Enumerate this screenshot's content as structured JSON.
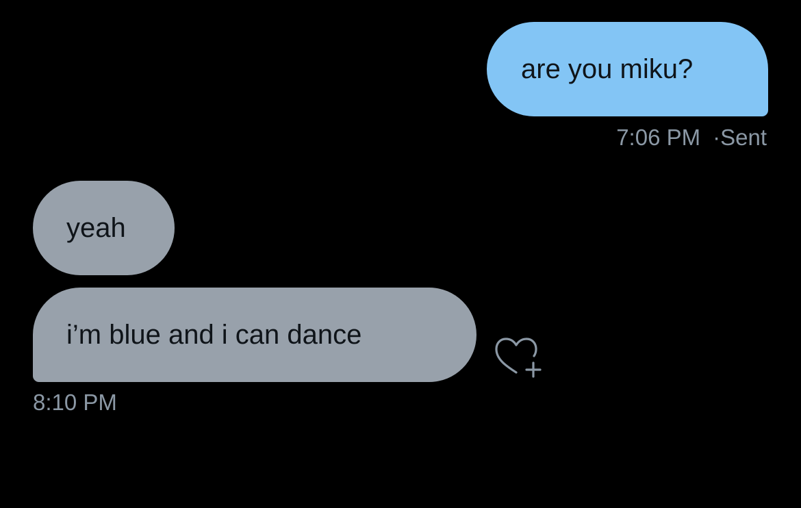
{
  "conversation": {
    "messages": [
      {
        "direction": "sent",
        "text": "are you miku?",
        "time": "7:06 PM",
        "separator": "·",
        "status": "Sent"
      },
      {
        "direction": "received",
        "text": "yeah"
      },
      {
        "direction": "received",
        "text": "i’m blue and i can dance",
        "time": "8:10 PM"
      }
    ]
  },
  "icons": {
    "reaction": "heart-plus-icon"
  },
  "colors": {
    "background": "#000000",
    "sent_bubble": "#83c5f5",
    "received_bubble": "#98a1ab",
    "bubble_text": "#0f1419",
    "meta_text": "#8b98a5"
  }
}
